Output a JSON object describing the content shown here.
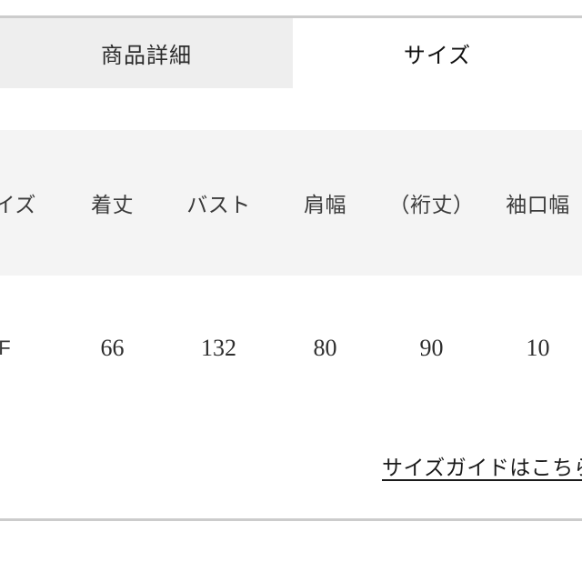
{
  "tabs": [
    {
      "id": "product-detail",
      "label": "商品詳細",
      "active": false
    },
    {
      "id": "size",
      "label": "サイズ",
      "active": true
    }
  ],
  "size_table": {
    "headers": [
      "サイズ",
      "着丈",
      "バスト",
      "肩幅",
      "（裄丈）",
      "袖口幅"
    ],
    "rows": [
      {
        "size": "F",
        "values": [
          "66",
          "132",
          "80",
          "90",
          "10"
        ]
      }
    ]
  },
  "size_guide": {
    "link_label": "サイズガイドはこちら"
  },
  "colors": {
    "rule": "#cccccc",
    "inactive_tab_bg": "#eeeeee",
    "table_header_bg": "#f4f4f4",
    "text": "#2e2e2e"
  }
}
